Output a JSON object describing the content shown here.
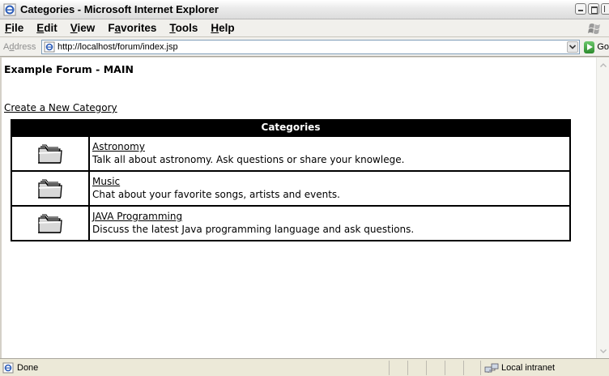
{
  "window": {
    "title": "Categories - Microsoft Internet Explorer"
  },
  "menu": {
    "items": [
      {
        "access": "F",
        "rest": "ile"
      },
      {
        "access": "E",
        "rest": "dit"
      },
      {
        "access": "V",
        "rest": "iew"
      },
      {
        "pre": "F",
        "access": "a",
        "rest": "vorites"
      },
      {
        "access": "T",
        "rest": "ools"
      },
      {
        "access": "H",
        "rest": "elp"
      }
    ]
  },
  "address_bar": {
    "label_pre": "A",
    "label_access": "d",
    "label_rest": "dress",
    "url": "http://localhost/forum/index.jsp",
    "go_label": "Go"
  },
  "page": {
    "forum_title": "Example Forum - MAIN",
    "create_link": "Create a New Category",
    "table_header": "Categories",
    "categories": [
      {
        "name": "Astronomy",
        "description": "Talk all about astronomy. Ask questions or share your knowlege."
      },
      {
        "name": "Music",
        "description": "Chat about your favorite songs, artists and events."
      },
      {
        "name": "JAVA Programming",
        "description": "Discuss the latest Java programming language and ask questions."
      }
    ]
  },
  "status_bar": {
    "text": "Done",
    "zone": "Local intranet"
  },
  "colors": {
    "table_header_bg": "#000000",
    "address_border": "#7f9db9",
    "go_green": "#2e8b2e"
  },
  "icons": [
    "ie-page-icon",
    "windows-flag-icon",
    "folder-icon",
    "local-intranet-icon"
  ]
}
